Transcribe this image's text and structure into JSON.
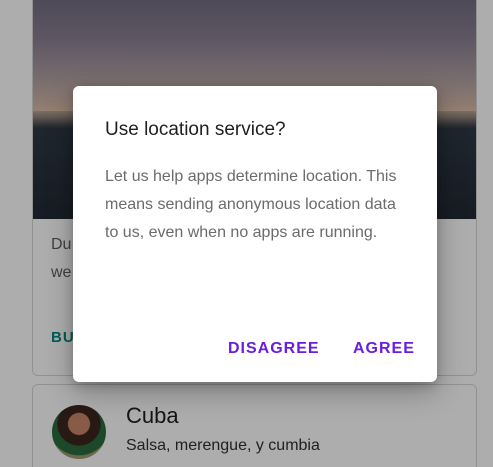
{
  "background": {
    "card1": {
      "text_line1": "Du",
      "text_line2": "we",
      "action_label": "BU"
    },
    "card2": {
      "title": "Cuba",
      "subtitle": "Salsa, merengue, y cumbia"
    }
  },
  "dialog": {
    "title": "Use location service?",
    "body": "Let us help apps determine location. This means sending anonymous location data to us, even when no apps are running.",
    "disagree_label": "DISAGREE",
    "agree_label": "AGREE"
  },
  "colors": {
    "accent": "#6a1de0",
    "card_action": "#00897b"
  }
}
